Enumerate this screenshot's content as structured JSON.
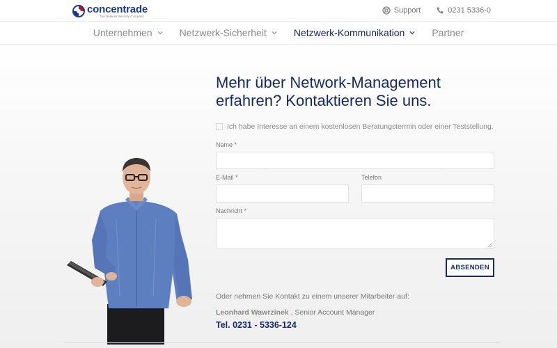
{
  "brand": {
    "name": "concentrade",
    "tagline": "The Network Security Company",
    "colors": {
      "primary": "#14296b",
      "accent": "#c8102e"
    }
  },
  "topbar": {
    "support_label": "Support",
    "support_icon": "lifebuoy-icon",
    "phone_label": "0231 5336-0",
    "phone_icon": "phone-icon"
  },
  "nav": {
    "items": [
      {
        "label": "Unternehmen",
        "has_dropdown": true,
        "active": false
      },
      {
        "label": "Netzwerk-Sicherheit",
        "has_dropdown": true,
        "active": false
      },
      {
        "label": "Netzwerk-Kommunikation",
        "has_dropdown": true,
        "active": true
      },
      {
        "label": "Partner",
        "has_dropdown": false,
        "active": false
      }
    ]
  },
  "form": {
    "headline_line1": "Mehr über Network-Management",
    "headline_line2": "erfahren? Kontaktieren Sie uns.",
    "consent_label": "Ich habe Interesse an einem kostenlosen Beratungstermin oder einer Teststellung.",
    "consent_checked": false,
    "name_label": "Name *",
    "name_value": "",
    "email_label": "E-Mail *",
    "email_value": "",
    "phone_label": "Telefon",
    "phone_value": "",
    "message_label": "Nachricht *",
    "message_value": "",
    "submit_label": "ABSENDEN"
  },
  "contact": {
    "intro": "Oder nehmen Sie Kontakt zu einem unserer Mitarbeiter auf:",
    "person_name": "Leonhard Wawrzinek",
    "person_role": ", Senior Account Manager",
    "phone": "Tel. 0231 - 5336-124"
  }
}
